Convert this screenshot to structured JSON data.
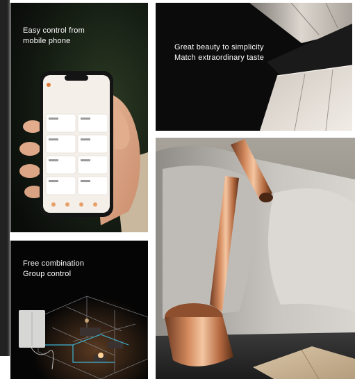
{
  "tiles": {
    "mobile": {
      "line1": "Easy control from",
      "line2": "mobile phone"
    },
    "beauty": {
      "line1": "Great beauty to simplicity",
      "line2": "Match extraordinary taste"
    },
    "combo": {
      "line1": "Free combination",
      "line2": "Group control"
    }
  },
  "colors": {
    "dark_tile": "#0d0d0d",
    "copper": "#c07a52",
    "panel_gold": "#cdb79a",
    "sofa_grey": "#b9b6b1"
  }
}
